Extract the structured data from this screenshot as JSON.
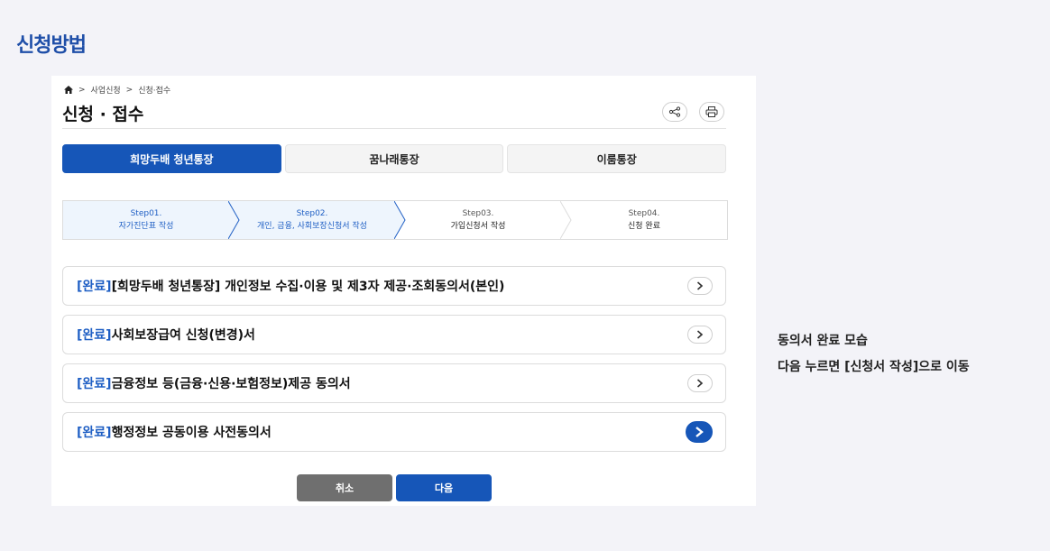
{
  "section_title": "신청방법",
  "breadcrumb": {
    "items": [
      "사업신청",
      "신청·접수"
    ],
    "separator": ">"
  },
  "page_title": "신청 · 접수",
  "tabs": [
    {
      "label": "희망두배 청년통장",
      "active": true
    },
    {
      "label": "꿈나래통장",
      "active": false
    },
    {
      "label": "이룸통장",
      "active": false
    }
  ],
  "steps": [
    {
      "num": "Step01.",
      "name": "자가진단표 작성",
      "active": true
    },
    {
      "num": "Step02.",
      "name": "개인, 금융, 사회보장신청서 작성",
      "active": true
    },
    {
      "num": "Step03.",
      "name": "가입신청서 작성",
      "active": false
    },
    {
      "num": "Step04.",
      "name": "신청 완료",
      "active": false
    }
  ],
  "items": [
    {
      "status": "[완료]",
      "title": "[희망두배 청년통장] 개인정보 수집·이용 및 제3자 제공·조회동의서(본인)",
      "highlight": false
    },
    {
      "status": "[완료]",
      "title": "사회보장급여 신청(변경)서",
      "highlight": false
    },
    {
      "status": "[완료]",
      "title": "금융정보 등(금융·신용·보험정보)제공 동의서",
      "highlight": false
    },
    {
      "status": "[완료]",
      "title": "행정정보 공동이용 사전동의서",
      "highlight": true
    }
  ],
  "buttons": {
    "cancel": "취소",
    "next": "다음"
  },
  "note": {
    "line1": "동의서 완료 모습",
    "line2": "다음 누르면 [신청서 작성]으로 이동"
  },
  "colors": {
    "primary": "#1656b8",
    "title": "#1f4fa8",
    "cancel": "#6f6f6f"
  }
}
